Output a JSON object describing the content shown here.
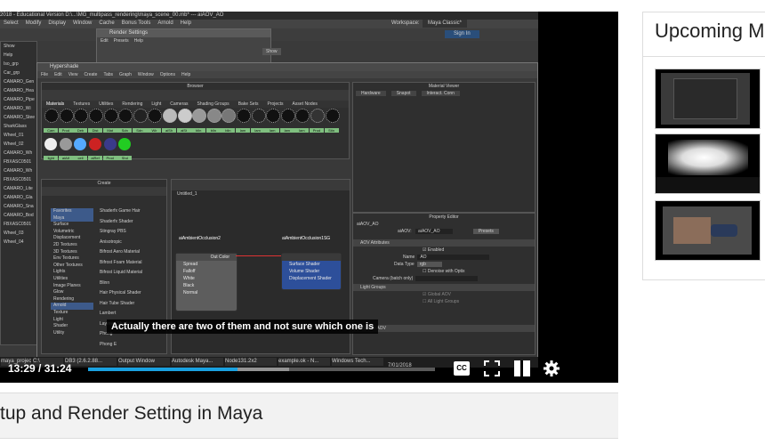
{
  "video": {
    "subtitle": "Actually there are two of them and not sure which one is",
    "current_time": "13:29",
    "separator": "/",
    "duration": "31:24",
    "progress_fraction": 0.43,
    "buffered_fraction": 0.58,
    "accent_color": "#1aa1e0",
    "controls": {
      "cc_label": "CC",
      "cc_icon": "cc-icon",
      "fullscreen_icon": "fullscreen-icon",
      "theater_icon": "theater-icon",
      "settings_icon": "gear-icon"
    }
  },
  "maya": {
    "title_bar": "2018 - Educational Version  D:\\...\\MG_multipass_rendering\\maya_scene_00.mb*  ---  aiAOV_AO",
    "menu": [
      "Select",
      "Modify",
      "Display",
      "Window",
      "Cache",
      "Bonus Tools",
      "Arnold",
      "Help"
    ],
    "workspace_label": "Workspace:",
    "workspace_value": "Maya Classic*",
    "sign_in": "Sign In",
    "render_settings": {
      "title": "Render Settings",
      "menu": [
        "Edit",
        "Presets",
        "Help"
      ],
      "show": "Show"
    },
    "hypershade": {
      "title": "Hypershade",
      "menu": [
        "File",
        "Edit",
        "View",
        "Create",
        "Tabs",
        "Graph",
        "Window",
        "Options",
        "Help"
      ],
      "browser_label": "Browser",
      "browser_tabs": [
        "Materials",
        "Textures",
        "Utilities",
        "Rendering",
        "Light",
        "Cameras",
        "Shading Groups",
        "Bake Sets",
        "Projects",
        "Asset Nodes"
      ],
      "swatches_row1": [
        "Cam",
        "Prod",
        "Deb",
        "Dist",
        "Mat",
        "Sdn",
        "Sdn",
        "Wir",
        "aiSh",
        "aiSt",
        "blin",
        "blin",
        "blin",
        "lam",
        "lam",
        "lam",
        "lam",
        "lam",
        "Prod",
        "Stin"
      ],
      "swatches_row2": [
        "light",
        "aiAtf",
        "cell",
        "aiRef",
        "Prod",
        "Shd"
      ],
      "material_viewer": "Material Viewer",
      "viewer_options": [
        "Hardware",
        "Snapot",
        "Interact. Conn"
      ],
      "create_label": "Create",
      "create_tree": [
        "Favorites",
        "Maya",
        "Surface",
        "Volumetric",
        "Displacement",
        "2D Textures",
        "3D Textures",
        "Env Textures",
        "Other Textures",
        "Lights",
        "Utilities",
        "Image Planes",
        "Glow",
        "Rendering",
        "Arnold",
        "Texture",
        "Light",
        "Shader",
        "Utility"
      ],
      "create_items": [
        "Shaderfx Game Hair",
        "Shaderfx Shader",
        "Stingray PBS",
        "Anisotropic",
        "Bifrost Aero Material",
        "Bifrost Foam Material",
        "Bifrost Liquid Material",
        "Blinn",
        "Hair Physical Shader",
        "Hair Tube Shader",
        "Lambert",
        "Layered Shader",
        "Phong",
        "Phong E"
      ],
      "graph_tab": "Untitled_1",
      "node1": {
        "title": "aiAmbientOcclusion2",
        "out": "Out Color",
        "rows": [
          "Spread",
          "Falloff",
          "White",
          "Black",
          "Normal"
        ]
      },
      "node2": {
        "title": "aiAmbientOcclusion1SG",
        "rows": [
          "Surface Shader",
          "Volume Shader",
          "Displacement Shader"
        ]
      },
      "property_editor": {
        "title": "Property Editor",
        "node_name": "aiAOV_AO",
        "field_label": "aiAOV:",
        "field_value": "aiAOV_AO",
        "presets": "Presets",
        "section1": "AOV Attributes",
        "enabled": "Enabled",
        "name_label": "Name",
        "name_value": "AO",
        "data_type_label": "Data Type",
        "data_type_value": "rgb",
        "denoise": "Denoise with Optix",
        "camera_label": "Camera (batch only)",
        "section2": "Light Groups",
        "global_aov": "Global AOV",
        "all_light_groups": "All Light Groups",
        "section3": "Custom AOV"
      }
    },
    "outliner": [
      "Show",
      "Help",
      "Iso_grp",
      "Car_grp",
      "CAMARO_Gen",
      "CAMARO_Hea",
      "CAMARO_Pipe",
      "CAMARO_Wi",
      "CAMARO_Stee",
      "SharkGlass",
      "Wheel_01",
      "Wheel_02",
      "CAMARO_Wh",
      "FBXASC0501",
      "CAMARO_Wh",
      "FBXASC0501",
      "CAMARO_Lite",
      "CAMARO_Gla",
      "CAMARO_Sna",
      "CAMARO_Bod",
      "FBXASC0501",
      "Wheel_03",
      "Wheel_04"
    ],
    "taskbar": [
      "maya_project",
      "C:\\",
      "DB3 (2.6.2.88...",
      "Output Window",
      "Autodesk Maya...",
      "Node131.2x2",
      "example.ok - N...",
      "Windows Tech..."
    ],
    "taskbar_date": "7/01/2018"
  },
  "sidebar": {
    "upcoming_title": "Upcoming M",
    "thumbnail_icons": [
      "maya-screenshot-thumbnail",
      "render-glow-thumbnail",
      "car-render-thumbnail"
    ]
  },
  "page": {
    "title": "tup and Render Setting in Maya"
  }
}
